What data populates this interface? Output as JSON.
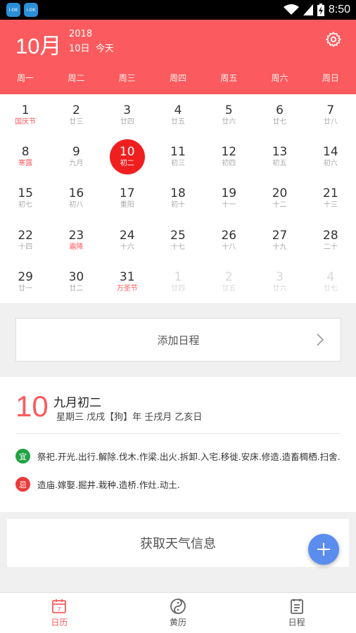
{
  "status_bar": {
    "time": "8:50",
    "app_icon_1": "i-OK",
    "app_icon_2": "i-OK"
  },
  "header": {
    "month": "10月",
    "year": "2018",
    "day": "10日",
    "today": "今天",
    "settings_icon": "gear-icon",
    "background": "#fb5b5e"
  },
  "weekdays": [
    "周一",
    "周二",
    "周三",
    "周四",
    "周五",
    "周六",
    "周日"
  ],
  "calendar": {
    "selected": "10",
    "weeks": [
      [
        {
          "d": "1",
          "l": "国庆节",
          "fest": true
        },
        {
          "d": "2",
          "l": "廿三"
        },
        {
          "d": "3",
          "l": "廿四"
        },
        {
          "d": "4",
          "l": "廿五"
        },
        {
          "d": "5",
          "l": "廿六"
        },
        {
          "d": "6",
          "l": "廿七"
        },
        {
          "d": "7",
          "l": "廿八"
        }
      ],
      [
        {
          "d": "8",
          "l": "寒露",
          "fest": true
        },
        {
          "d": "9",
          "l": "九月"
        },
        {
          "d": "10",
          "l": "初二",
          "sel": true
        },
        {
          "d": "11",
          "l": "初三"
        },
        {
          "d": "12",
          "l": "初四"
        },
        {
          "d": "13",
          "l": "初五"
        },
        {
          "d": "14",
          "l": "初六"
        }
      ],
      [
        {
          "d": "15",
          "l": "初七"
        },
        {
          "d": "16",
          "l": "初八"
        },
        {
          "d": "17",
          "l": "重阳"
        },
        {
          "d": "18",
          "l": "初十"
        },
        {
          "d": "19",
          "l": "十一"
        },
        {
          "d": "20",
          "l": "十二"
        },
        {
          "d": "21",
          "l": "十三"
        }
      ],
      [
        {
          "d": "22",
          "l": "十四"
        },
        {
          "d": "23",
          "l": "霜降",
          "fest": true
        },
        {
          "d": "24",
          "l": "十六"
        },
        {
          "d": "25",
          "l": "十七"
        },
        {
          "d": "26",
          "l": "十八"
        },
        {
          "d": "27",
          "l": "十九"
        },
        {
          "d": "28",
          "l": "二十"
        }
      ],
      [
        {
          "d": "29",
          "l": "廿一"
        },
        {
          "d": "30",
          "l": "廿二"
        },
        {
          "d": "31",
          "l": "万圣节",
          "fest": true
        },
        {
          "d": "1",
          "l": "廿四",
          "other": true
        },
        {
          "d": "2",
          "l": "廿五",
          "other": true
        },
        {
          "d": "3",
          "l": "廿六",
          "other": true
        },
        {
          "d": "4",
          "l": "廿七",
          "other": true
        }
      ]
    ]
  },
  "add_schedule": {
    "label": "添加日程",
    "icon": "chevron-right-icon"
  },
  "almanac": {
    "day": "10",
    "lunar": "九月初二",
    "detail": "星期三 戊戌【狗】年 壬戌月 乙亥日",
    "yi_badge": "宜",
    "yi_text": "祭祀.开光.出行.解除.伐木.作梁.出火.拆卸.入宅.移徙.安床.修造.造畜椆栖.扫舍.",
    "ji_badge": "忌",
    "ji_text": "造庙.嫁娶.掘井.栽种.造桥.作灶.动土."
  },
  "weather": {
    "label": "获取天气信息"
  },
  "fab": {
    "icon": "plus-icon",
    "color": "#5b8def"
  },
  "bottom_nav": [
    {
      "label": "日历",
      "icon": "calendar-icon",
      "active": true
    },
    {
      "label": "黄历",
      "icon": "yin-yang-icon"
    },
    {
      "label": "日程",
      "icon": "list-icon"
    }
  ]
}
